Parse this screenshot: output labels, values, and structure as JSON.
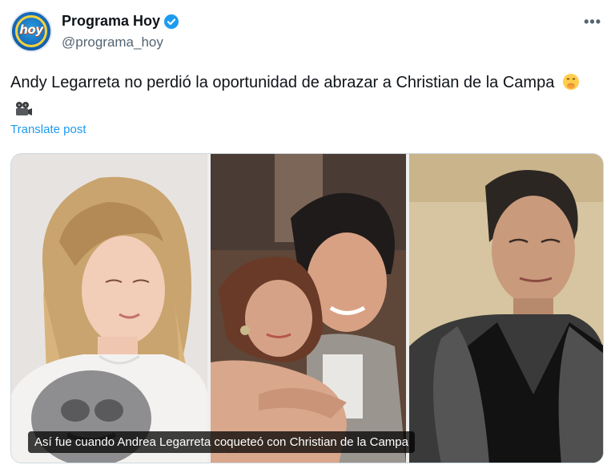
{
  "account": {
    "display_name": "Programa Hoy",
    "handle": "@programa_hoy",
    "avatar_text": "hoy",
    "verified": true
  },
  "more_label": "•••",
  "post": {
    "text": "Andy Legarreta no perdió la oportunidad de abrazar a Christian de la Campa",
    "emojis": [
      "hand-over-mouth-face",
      "movie-camera"
    ],
    "translate_label": "Translate post"
  },
  "media": {
    "panels": [
      "woman-portrait-photo",
      "hug-photo",
      "man-portrait-photo"
    ],
    "caption": "Así fue cuando Andrea Legarreta coqueteó con Christian de la Campa"
  },
  "colors": {
    "verified_blue": "#1d9bf0",
    "secondary_text": "#536471",
    "link_blue": "#1d9bf0"
  }
}
